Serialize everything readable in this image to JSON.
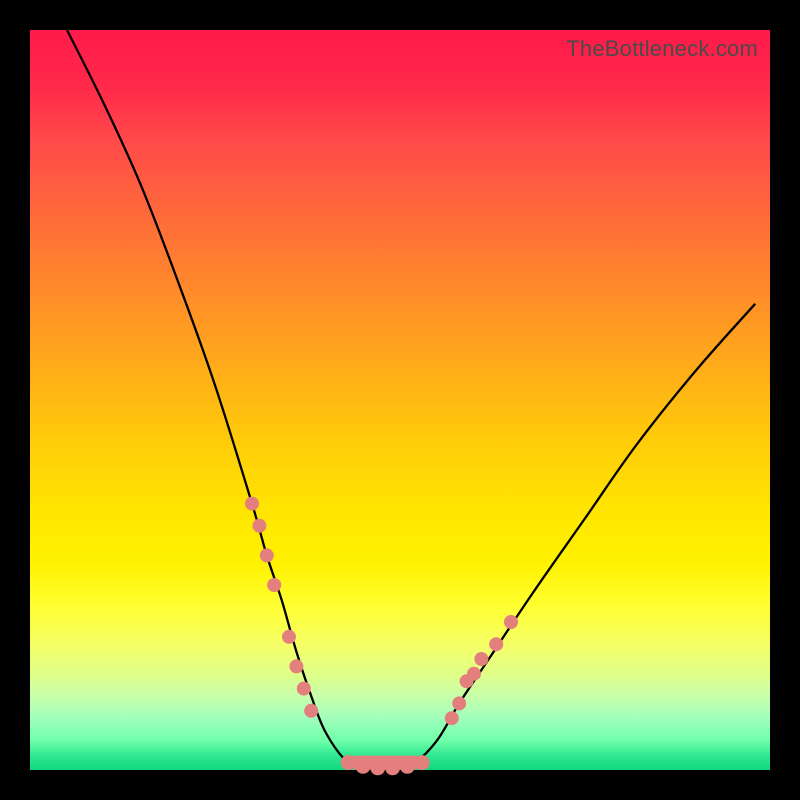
{
  "watermark": "TheBottleneck.com",
  "chart_data": {
    "type": "line",
    "title": "",
    "xlabel": "",
    "ylabel": "",
    "xlim": [
      0,
      100
    ],
    "ylim": [
      0,
      100
    ],
    "background_gradient": {
      "top_color": "#ff1a4a",
      "bottom_color": "#10d880",
      "description": "vertical gradient red (high bottleneck) to green (optimal)"
    },
    "series": [
      {
        "name": "bottleneck-curve",
        "description": "V-shaped bottleneck curve; y represents bottleneck % (higher = worse)",
        "x": [
          5,
          10,
          15,
          20,
          25,
          30,
          32,
          34,
          36,
          38,
          40,
          43,
          46,
          49,
          52,
          55,
          58,
          62,
          68,
          75,
          82,
          90,
          98
        ],
        "values": [
          100,
          90,
          79,
          66,
          52,
          36,
          29,
          23,
          16,
          10,
          5,
          1,
          0,
          0,
          1,
          4,
          9,
          15,
          24,
          34,
          44,
          54,
          63
        ]
      }
    ],
    "markers": {
      "description": "highlighted data points on the curve (salmon dots)",
      "left_branch": [
        [
          30,
          36
        ],
        [
          31,
          33
        ],
        [
          32,
          29
        ],
        [
          33,
          25
        ],
        [
          35,
          18
        ],
        [
          36,
          14
        ],
        [
          37,
          11
        ],
        [
          38,
          8
        ]
      ],
      "valley": [
        [
          43,
          1
        ],
        [
          45,
          0.5
        ],
        [
          47,
          0.3
        ],
        [
          49,
          0.3
        ],
        [
          51,
          0.5
        ],
        [
          53,
          1
        ]
      ],
      "right_branch": [
        [
          57,
          7
        ],
        [
          58,
          9
        ],
        [
          59,
          12
        ],
        [
          60,
          13
        ],
        [
          61,
          15
        ],
        [
          63,
          17
        ],
        [
          65,
          20
        ]
      ]
    }
  }
}
